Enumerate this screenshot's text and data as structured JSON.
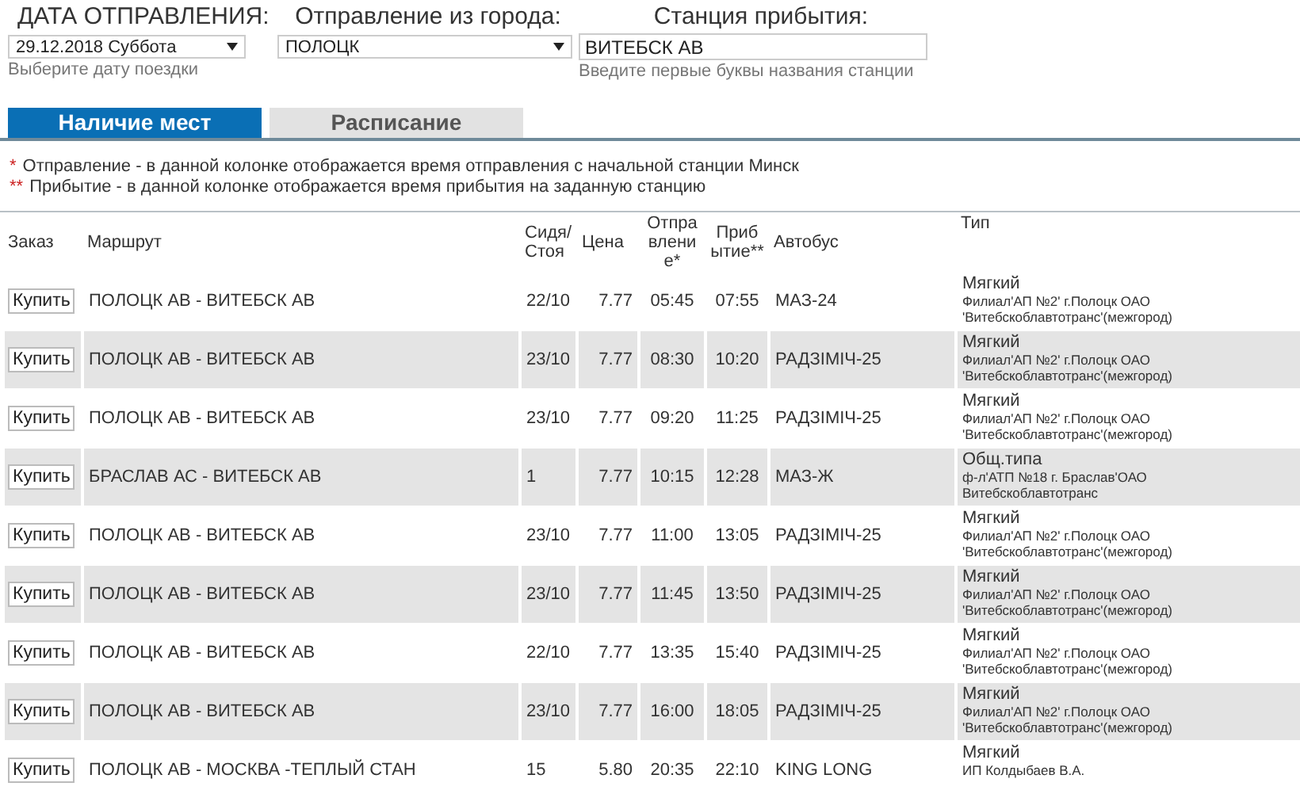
{
  "filters": [
    {
      "kind": "select",
      "label": "ДАТА ОТПРАВЛЕНИЯ:",
      "value": "29.12.2018 Суббота",
      "hint": "Выберите дату поездки"
    },
    {
      "kind": "select",
      "label": "Отправление из города:",
      "value": "ПОЛОЦК"
    },
    {
      "kind": "input",
      "label": "Станция прибытия:",
      "value": "ВИТЕБСК АВ",
      "hint": "Введите первые буквы названия станции"
    }
  ],
  "tabs": [
    {
      "label": "Наличие мест",
      "selected": true
    },
    {
      "label": "Расписание",
      "selected": false
    }
  ],
  "notes": [
    {
      "mark": "*",
      "text": "Отправление - в данной колонке отображается время отправления с начальной станции Минск"
    },
    {
      "mark": "**",
      "text": "Прибытие - в данной колонке отображается время прибытия на заданную станцию"
    }
  ],
  "table": {
    "columns": [
      "Заказ",
      "Маршрут",
      "Сидя/Стоя",
      "Цена",
      "Отправление*",
      "Прибытие**",
      "Автобус",
      "Тип"
    ],
    "rows": [
      {
        "button": "Купить",
        "route": "ПОЛОЦК АВ - ВИТЕБСК АВ",
        "seats": "22/10",
        "price": "7.77",
        "departure": "05:45",
        "arrival": "07:55",
        "bus": "МАЗ-24",
        "type": "Мягкий",
        "carrier": "Филиал'АП №2' г.Полоцк ОАО 'Витебскоблавтотранс'(межгород)"
      },
      {
        "button": "Купить",
        "route": "ПОЛОЦК АВ - ВИТЕБСК АВ",
        "seats": "23/10",
        "price": "7.77",
        "departure": "08:30",
        "arrival": "10:20",
        "bus": "РАДЗІМІЧ-25",
        "type": "Мягкий",
        "carrier": "Филиал'АП №2' г.Полоцк ОАО 'Витебскоблавтотранс'(межгород)"
      },
      {
        "button": "Купить",
        "route": "ПОЛОЦК АВ - ВИТЕБСК АВ",
        "seats": "23/10",
        "price": "7.77",
        "departure": "09:20",
        "arrival": "11:25",
        "bus": "РАДЗІМІЧ-25",
        "type": "Мягкий",
        "carrier": "Филиал'АП №2' г.Полоцк ОАО 'Витебскоблавтотранс'(межгород)"
      },
      {
        "button": "Купить",
        "route": "БРАСЛАВ АС - ВИТЕБСК АВ",
        "seats": "1",
        "price": "7.77",
        "departure": "10:15",
        "arrival": "12:28",
        "bus": "МАЗ-Ж",
        "type": "Общ.типа",
        "carrier": "ф-л'АТП №18 г. Браслав'ОАО Витебскоблавтотранс"
      },
      {
        "button": "Купить",
        "route": "ПОЛОЦК АВ - ВИТЕБСК АВ",
        "seats": "23/10",
        "price": "7.77",
        "departure": "11:00",
        "arrival": "13:05",
        "bus": "РАДЗІМІЧ-25",
        "type": "Мягкий",
        "carrier": "Филиал'АП №2' г.Полоцк ОАО 'Витебскоблавтотранс'(межгород)"
      },
      {
        "button": "Купить",
        "route": "ПОЛОЦК АВ - ВИТЕБСК АВ",
        "seats": "23/10",
        "price": "7.77",
        "departure": "11:45",
        "arrival": "13:50",
        "bus": "РАДЗІМІЧ-25",
        "type": "Мягкий",
        "carrier": "Филиал'АП №2' г.Полоцк ОАО 'Витебскоблавтотранс'(межгород)"
      },
      {
        "button": "Купить",
        "route": "ПОЛОЦК АВ - ВИТЕБСК АВ",
        "seats": "22/10",
        "price": "7.77",
        "departure": "13:35",
        "arrival": "15:40",
        "bus": "РАДЗІМІЧ-25",
        "type": "Мягкий",
        "carrier": "Филиал'АП №2' г.Полоцк ОАО 'Витебскоблавтотранс'(межгород)"
      },
      {
        "button": "Купить",
        "route": "ПОЛОЦК АВ - ВИТЕБСК АВ",
        "seats": "23/10",
        "price": "7.77",
        "departure": "16:00",
        "arrival": "18:05",
        "bus": "РАДЗІМІЧ-25",
        "type": "Мягкий",
        "carrier": "Филиал'АП №2' г.Полоцк ОАО 'Витебскоблавтотранс'(межгород)"
      },
      {
        "button": "Купить",
        "route": "ПОЛОЦК АВ - МОСКВА -ТЕПЛЫЙ СТАН",
        "seats": "15",
        "price": "5.80",
        "departure": "20:35",
        "arrival": "22:10",
        "bus": "KING LONG",
        "type": "Мягкий",
        "carrier": "ИП Колдыбаев В.А."
      }
    ]
  }
}
